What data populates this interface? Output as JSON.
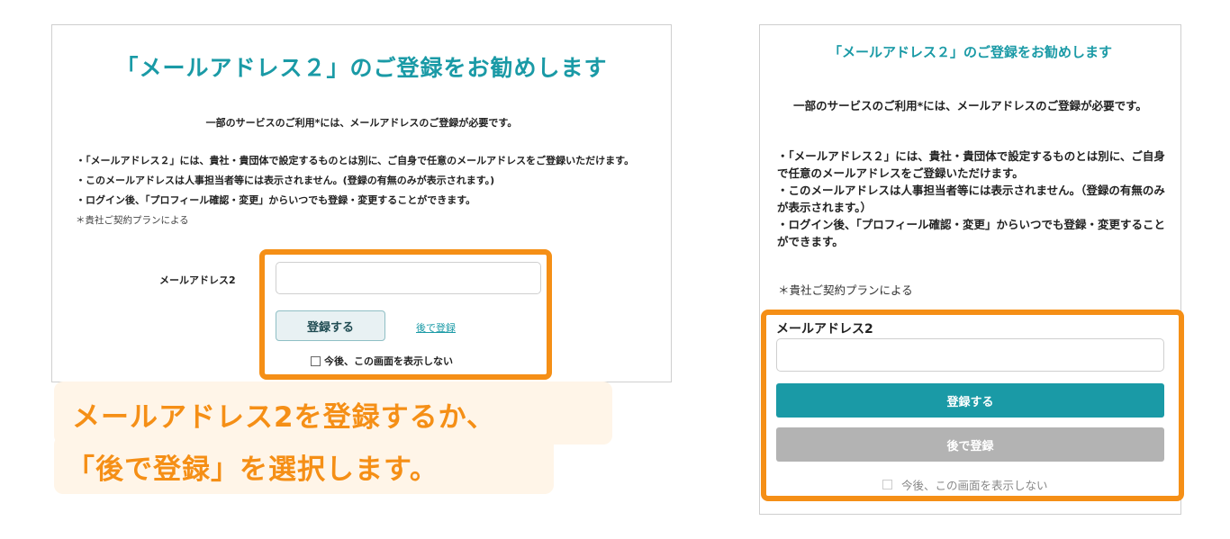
{
  "desktop": {
    "title": "「メールアドレス２」のご登録をお勧めします",
    "intro": "一部のサービスのご利用*には、メールアドレスのご登録が必要です。",
    "bullets": [
      "・「メールアドレス２」には、貴社・貴団体で設定するものとは別に、ご自身で任意のメールアドレスをご登録いただけます。",
      "・このメールアドレスは人事担当者等には表示されません。(登録の有無のみが表示されます。)",
      "・ログイン後、「プロフィール確認・変更」からいつでも登録・変更することができます。"
    ],
    "note": "＊貴社ご契約プランによる",
    "field_label": "メールアドレス2",
    "input_value": "",
    "register_button": "登録する",
    "later_link": "後で登録",
    "checkbox_label": "今後、この画面を表示しない"
  },
  "callout": {
    "line1": "メールアドレス2を登録するか、",
    "line2": "「後で登録」を選択します。"
  },
  "mobile": {
    "title": "「メールアドレス２」のご登録をお勧めします",
    "intro": "一部のサービスのご利用*には、メールアドレスのご登録が必要です。",
    "bullets": [
      "・「メールアドレス２」には、貴社・貴団体で設定するものとは別に、ご自身で任意のメールアドレスをご登録いただけます。",
      "・このメールアドレスは人事担当者等には表示されません。（登録の有無のみが表示されます。）",
      "・ログイン後、「プロフィール確認・変更」からいつでも登録・変更することができます。"
    ],
    "note": "＊貴社ご契約プランによる",
    "field_label": "メールアドレス2",
    "input_value": "",
    "register_button": "登録する",
    "later_button": "後で登録",
    "checkbox_label": "今後、この画面を表示しない"
  },
  "colors": {
    "accent": "#1a9aa6",
    "highlight": "#f58f16",
    "callout_bg": "#fff5e8"
  }
}
